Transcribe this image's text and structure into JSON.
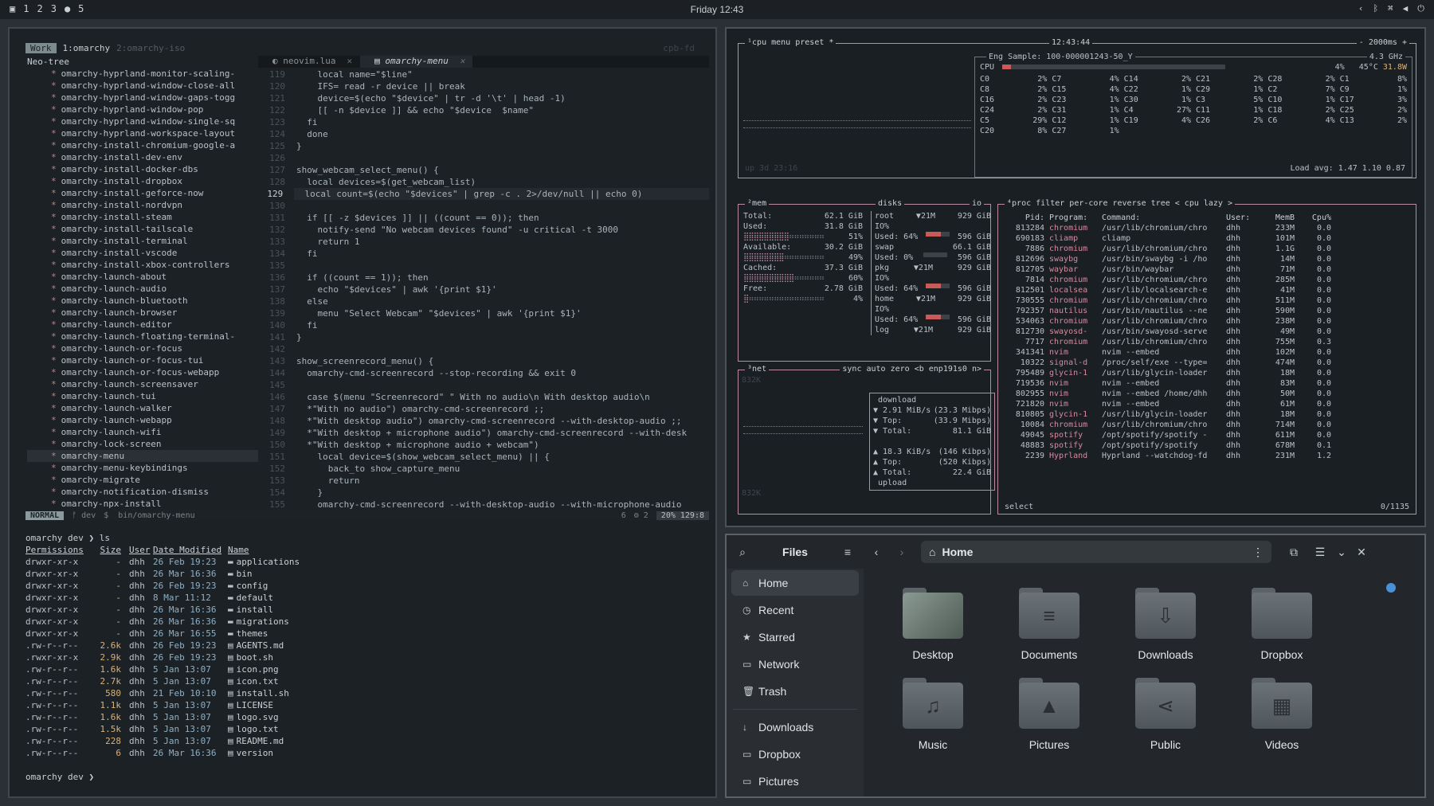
{
  "topbar": {
    "workspaces": [
      "1",
      "2",
      "3",
      "5"
    ],
    "clock": "Friday 12:43"
  },
  "editor": {
    "workspace_tag": "Work",
    "tabs_header": [
      "1:omarchy",
      "2:omarchy-iso"
    ],
    "cwd": "cpb-fd",
    "tree_root": "Neo-tree",
    "tree_items": [
      "omarchy-hyprland-monitor-scaling-",
      "omarchy-hyprland-window-close-all",
      "omarchy-hyprland-window-gaps-togg",
      "omarchy-hyprland-window-pop",
      "omarchy-hyprland-window-single-sq",
      "omarchy-hyprland-workspace-layout",
      "omarchy-install-chromium-google-a",
      "omarchy-install-dev-env",
      "omarchy-install-docker-dbs",
      "omarchy-install-dropbox",
      "omarchy-install-geforce-now",
      "omarchy-install-nordvpn",
      "omarchy-install-steam",
      "omarchy-install-tailscale",
      "omarchy-install-terminal",
      "omarchy-install-vscode",
      "omarchy-install-xbox-controllers",
      "omarchy-launch-about",
      "omarchy-launch-audio",
      "omarchy-launch-bluetooth",
      "omarchy-launch-browser",
      "omarchy-launch-editor",
      "omarchy-launch-floating-terminal-",
      "omarchy-launch-or-focus",
      "omarchy-launch-or-focus-tui",
      "omarchy-launch-or-focus-webapp",
      "omarchy-launch-screensaver",
      "omarchy-launch-tui",
      "omarchy-launch-walker",
      "omarchy-launch-webapp",
      "omarchy-launch-wifi",
      "omarchy-lock-screen",
      "omarchy-menu",
      "omarchy-menu-keybindings",
      "omarchy-migrate",
      "omarchy-notification-dismiss",
      "omarchy-npx-install"
    ],
    "file_tabs": [
      "neovim.lua",
      "omarchy-menu"
    ],
    "code": [
      [
        "119",
        "    local name=\"$line\""
      ],
      [
        "120",
        "    IFS= read -r device || break"
      ],
      [
        "121",
        "    device=$(echo \"$device\" | tr -d '\\t' | head -1)"
      ],
      [
        "122",
        "    [[ -n $device ]] && echo \"$device  $name\""
      ],
      [
        "123",
        "  fi"
      ],
      [
        "124",
        "  done"
      ],
      [
        "125",
        "}"
      ],
      [
        "126",
        ""
      ],
      [
        "127",
        "show_webcam_select_menu() {"
      ],
      [
        "128",
        "  local devices=$(get_webcam_list)"
      ],
      [
        "129",
        "  local count=$(echo \"$devices\" | grep -c . 2>/dev/null || echo 0)"
      ],
      [
        "130",
        ""
      ],
      [
        "131",
        "  if [[ -z $devices ]] || ((count == 0)); then"
      ],
      [
        "132",
        "    notify-send \"No webcam devices found\" -u critical -t 3000"
      ],
      [
        "133",
        "    return 1"
      ],
      [
        "134",
        "  fi"
      ],
      [
        "135",
        ""
      ],
      [
        "136",
        "  if ((count == 1)); then"
      ],
      [
        "137",
        "    echo \"$devices\" | awk '{print $1}'"
      ],
      [
        "138",
        "  else"
      ],
      [
        "139",
        "    menu \"Select Webcam\" \"$devices\" | awk '{print $1}'"
      ],
      [
        "140",
        "  fi"
      ],
      [
        "141",
        "}"
      ],
      [
        "142",
        ""
      ],
      [
        "143",
        "show_screenrecord_menu() {"
      ],
      [
        "144",
        "  omarchy-cmd-screenrecord --stop-recording && exit 0"
      ],
      [
        "145",
        ""
      ],
      [
        "146",
        "  case $(menu \"Screenrecord\" \" With no audio\\n With desktop audio\\n"
      ],
      [
        "147",
        "  *\"With no audio\") omarchy-cmd-screenrecord ;;"
      ],
      [
        "148",
        "  *\"With desktop audio\") omarchy-cmd-screenrecord --with-desktop-audio ;;"
      ],
      [
        "149",
        "  *\"With desktop + microphone audio\") omarchy-cmd-screenrecord --with-desk"
      ],
      [
        "150",
        "  *\"With desktop + microphone audio + webcam\")"
      ],
      [
        "151",
        "    local device=$(show_webcam_select_menu) || {"
      ],
      [
        "152",
        "      back_to show_capture_menu"
      ],
      [
        "153",
        "      return"
      ],
      [
        "154",
        "    }"
      ],
      [
        "155",
        "    omarchy-cmd-screenrecord --with-desktop-audio --with-microphone-audio"
      ]
    ],
    "current_line": "129",
    "statusline": {
      "mode": "NORMAL",
      "branch": "dev",
      "path": "bin/omarchy-menu",
      "diag": "6",
      "lsp": "2",
      "percent": "20%",
      "pos": "129:8"
    }
  },
  "terminal": {
    "prompt1": "omarchy dev ❯ ls",
    "headers": [
      "Permissions",
      "Size",
      "User",
      "Date Modified",
      "Name"
    ],
    "rows": [
      [
        "drwxr-xr-x",
        "-",
        "dhh",
        "26 Feb 19:23",
        "applications"
      ],
      [
        "drwxr-xr-x",
        "-",
        "dhh",
        "26 Mar 16:36",
        "bin"
      ],
      [
        "drwxr-xr-x",
        "-",
        "dhh",
        "26 Feb 19:23",
        "config"
      ],
      [
        "drwxr-xr-x",
        "-",
        "dhh",
        "8 Mar 11:12",
        "default"
      ],
      [
        "drwxr-xr-x",
        "-",
        "dhh",
        "26 Mar 16:36",
        "install"
      ],
      [
        "drwxr-xr-x",
        "-",
        "dhh",
        "26 Mar 16:36",
        "migrations"
      ],
      [
        "drwxr-xr-x",
        "-",
        "dhh",
        "26 Mar 16:55",
        "themes"
      ],
      [
        ".rw-r--r--",
        "2.6k",
        "dhh",
        "26 Feb 19:23",
        "AGENTS.md"
      ],
      [
        ".rwxr-xr-x",
        "2.9k",
        "dhh",
        "26 Feb 19:23",
        "boot.sh"
      ],
      [
        ".rw-r--r--",
        "1.6k",
        "dhh",
        "5 Jan 13:07",
        "icon.png"
      ],
      [
        ".rw-r--r--",
        "2.7k",
        "dhh",
        "5 Jan 13:07",
        "icon.txt"
      ],
      [
        ".rw-r--r--",
        "580",
        "dhh",
        "21 Feb 10:10",
        "install.sh"
      ],
      [
        ".rw-r--r--",
        "1.1k",
        "dhh",
        "5 Jan 13:07",
        "LICENSE"
      ],
      [
        ".rw-r--r--",
        "1.6k",
        "dhh",
        "5 Jan 13:07",
        "logo.svg"
      ],
      [
        ".rw-r--r--",
        "1.5k",
        "dhh",
        "5 Jan 13:07",
        "logo.txt"
      ],
      [
        ".rw-r--r--",
        "228",
        "dhh",
        "5 Jan 13:07",
        "README.md"
      ],
      [
        ".rw-r--r--",
        "6",
        "dhh",
        "26 Mar 16:36",
        "version"
      ]
    ],
    "prompt2": "omarchy dev ❯"
  },
  "btop": {
    "cpu_title": "cpu",
    "menu_label": "menu",
    "preset_label": "preset *",
    "clock": "12:43:44",
    "refresh": "- 2000ms +",
    "model": "Eng Sample: 100-000001243-50_Y",
    "freq": "4.3 GHz",
    "cpu_total": "4%",
    "temp": "45°C",
    "watts": "31.8W",
    "uptime": "up 3d 23:16",
    "cores": [
      [
        "C0",
        "2%"
      ],
      [
        "C7",
        "4%"
      ],
      [
        "C14",
        "2%"
      ],
      [
        "C21",
        "2%"
      ],
      [
        "C28",
        "2%"
      ],
      [
        "C1",
        "8%"
      ],
      [
        "C8",
        "2%"
      ],
      [
        "C15",
        "4%"
      ],
      [
        "C22",
        "1%"
      ],
      [
        "C29",
        "1%"
      ],
      [
        "C2",
        "7%"
      ],
      [
        "C9",
        "1%"
      ],
      [
        "C16",
        "2%"
      ],
      [
        "C23",
        "1%"
      ],
      [
        "C30",
        "1%"
      ],
      [
        "C3",
        "5%"
      ],
      [
        "C10",
        "1%"
      ],
      [
        "C17",
        "3%"
      ],
      [
        "C24",
        "2%"
      ],
      [
        "C31",
        "1%"
      ],
      [
        "C4",
        "27%"
      ],
      [
        "C11",
        "1%"
      ],
      [
        "C18",
        "2%"
      ],
      [
        "C25",
        "2%"
      ],
      [
        "C5",
        "29%"
      ],
      [
        "C12",
        "1%"
      ],
      [
        "C19",
        "4%"
      ],
      [
        "C26",
        "2%"
      ],
      [
        "C6",
        "4%"
      ],
      [
        "C13",
        "2%"
      ],
      [
        "C20",
        "8%"
      ],
      [
        "C27",
        "1%"
      ]
    ],
    "load": "Load avg: 1.47 1.10 0.87",
    "mem_title": "mem",
    "mem": [
      [
        "Total:",
        "62.1 GiB",
        ""
      ],
      [
        "Used:",
        "31.8 GiB",
        "51%"
      ],
      [
        "Available:",
        "30.2 GiB",
        "49%"
      ],
      [
        "Cached:",
        "37.3 GiB",
        "60%"
      ],
      [
        "Free:",
        "2.78 GiB",
        "4%"
      ]
    ],
    "disks_title": "disks",
    "disks": [
      [
        "root",
        "▼21M",
        "929 GiB",
        "IO%",
        "Used: 64%",
        "596 GiB"
      ],
      [
        "swap",
        "",
        "66.1 GiB",
        "",
        "Used: 0%",
        "596 GiB"
      ],
      [
        "pkg",
        "▼21M",
        "929 GiB",
        "IO%",
        "Used: 64%",
        "596 GiB"
      ],
      [
        "home",
        "▼21M",
        "929 GiB",
        "IO%",
        "Used: 64%",
        "596 GiB"
      ],
      [
        "log",
        "▼21M",
        "929 GiB",
        "",
        "",
        ""
      ]
    ],
    "io_label": "io",
    "net_title": "net",
    "net_opts": "sync auto zero <b enp191s0 n>",
    "net_scale_top": "832K",
    "net_scale_bot": "832K",
    "download_label": "download",
    "download": [
      "▼ 2.91 MiB/s",
      "(23.3 Mibps)",
      "▼ Top:",
      "(33.9 Mibps)",
      "▼ Total:",
      "81.1 GiB"
    ],
    "upload": [
      "▲ 18.3 KiB/s",
      "(146 Kibps)",
      "▲ Top:",
      "(520 Kibps)",
      "▲ Total:",
      "22.4 GiB"
    ],
    "upload_label": "upload",
    "proc_title": "proc",
    "proc_opts": "filter  per-core reverse tree < cpu lazy >",
    "proc_headers": [
      "Pid:",
      "Program:",
      "Command:",
      "User:",
      "MemB",
      "Cpu%"
    ],
    "procs": [
      [
        "813284",
        "chromium",
        "/usr/lib/chromium/chro",
        "dhh",
        "233M",
        "0.0"
      ],
      [
        "690183",
        "cliamp",
        "cliamp",
        "dhh",
        "101M",
        "0.0"
      ],
      [
        "7886",
        "chromium",
        "/usr/lib/chromium/chro",
        "dhh",
        "1.1G",
        "0.0"
      ],
      [
        "812696",
        "swaybg",
        "/usr/bin/swaybg -i /ho",
        "dhh",
        "14M",
        "0.0"
      ],
      [
        "812705",
        "waybar",
        "/usr/bin/waybar",
        "dhh",
        "71M",
        "0.0"
      ],
      [
        "7814",
        "chromium",
        "/usr/lib/chromium/chro",
        "dhh",
        "285M",
        "0.0"
      ],
      [
        "812501",
        "localsea",
        "/usr/lib/localsearch-e",
        "dhh",
        "41M",
        "0.0"
      ],
      [
        "730555",
        "chromium",
        "/usr/lib/chromium/chro",
        "dhh",
        "511M",
        "0.0"
      ],
      [
        "792357",
        "nautilus",
        "/usr/bin/nautilus --ne",
        "dhh",
        "590M",
        "0.0"
      ],
      [
        "534063",
        "chromium",
        "/usr/lib/chromium/chro",
        "dhh",
        "238M",
        "0.0"
      ],
      [
        "812730",
        "swayosd-",
        "/usr/bin/swayosd-serve",
        "dhh",
        "49M",
        "0.0"
      ],
      [
        "7717",
        "chromium",
        "/usr/lib/chromium/chro",
        "dhh",
        "755M",
        "0.3"
      ],
      [
        "341341",
        "nvim",
        "nvim --embed",
        "dhh",
        "102M",
        "0.0"
      ],
      [
        "10322",
        "signal-d",
        "/proc/self/exe --type=",
        "dhh",
        "474M",
        "0.0"
      ],
      [
        "795489",
        "glycin-1",
        "/usr/lib/glycin-loader",
        "dhh",
        "18M",
        "0.0"
      ],
      [
        "719536",
        "nvim",
        "nvim --embed",
        "dhh",
        "83M",
        "0.0"
      ],
      [
        "802955",
        "nvim",
        "nvim --embed /home/dhh",
        "dhh",
        "50M",
        "0.0"
      ],
      [
        "721820",
        "nvim",
        "nvim --embed",
        "dhh",
        "61M",
        "0.0"
      ],
      [
        "810805",
        "glycin-1",
        "/usr/lib/glycin-loader",
        "dhh",
        "18M",
        "0.0"
      ],
      [
        "10084",
        "chromium",
        "/usr/lib/chromium/chro",
        "dhh",
        "714M",
        "0.0"
      ],
      [
        "49045",
        "spotify",
        "/opt/spotify/spotify -",
        "dhh",
        "611M",
        "0.0"
      ],
      [
        "48883",
        "spotify",
        "/opt/spotify/spotify",
        "dhh",
        "678M",
        "0.1"
      ],
      [
        "2239",
        "Hyprland",
        "Hyprland --watchdog-fd",
        "dhh",
        "231M",
        "1.2"
      ]
    ],
    "proc_footer": "select",
    "proc_count": "0/1135"
  },
  "files": {
    "app_title": "Files",
    "location": "Home",
    "sidebar": [
      {
        "label": "Home",
        "icon": "⌂"
      },
      {
        "label": "Recent",
        "icon": "◷"
      },
      {
        "label": "Starred",
        "icon": "★"
      },
      {
        "label": "Network",
        "icon": "▭"
      },
      {
        "label": "Trash",
        "icon": "🗑"
      },
      {
        "label": "Downloads",
        "icon": "↓"
      },
      {
        "label": "Dropbox",
        "icon": "▭"
      },
      {
        "label": "Pictures",
        "icon": "▭"
      }
    ],
    "folders": [
      {
        "label": "Desktop",
        "glyph": ""
      },
      {
        "label": "Documents",
        "glyph": "≡"
      },
      {
        "label": "Downloads",
        "glyph": "⇩"
      },
      {
        "label": "Dropbox",
        "glyph": ""
      },
      {
        "label": "Music",
        "glyph": "♫"
      },
      {
        "label": "Pictures",
        "glyph": "▲"
      },
      {
        "label": "Public",
        "glyph": "⋖"
      },
      {
        "label": "Videos",
        "glyph": "▦"
      }
    ],
    "accent": "#4a90d9"
  }
}
